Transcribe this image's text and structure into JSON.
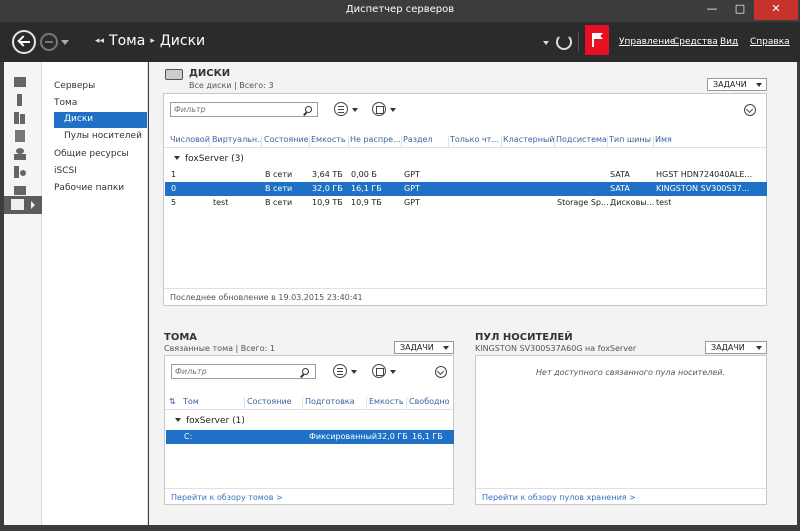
{
  "window": {
    "title": "Диспетчер серверов",
    "minimize": "—",
    "maximize": "□",
    "close": "✕"
  },
  "toolbar": {
    "breadcrumb": [
      "Тома",
      "Диски"
    ],
    "menus": [
      "Управление",
      "Средства",
      "Вид",
      "Справка"
    ]
  },
  "sidebar": {
    "items": [
      "Серверы",
      "Тома",
      "Диски",
      "Пулы носителей",
      "Общие ресурсы",
      "iSCSI",
      "Рабочие папки"
    ]
  },
  "disks": {
    "title": "ДИСКИ",
    "subtitle": "Все диски | Всего: 3",
    "tasks": "ЗАДАЧИ",
    "filter_placeholder": "Фильтр",
    "columns": [
      "Числовой",
      "Виртуальн...",
      "Состояние",
      "Емкость",
      "Не распре...",
      "Раздел",
      "Только чт...",
      "Кластерный",
      "Подсистема",
      "Тип шины",
      "Имя"
    ],
    "group": "foxServer (3)",
    "rows": [
      [
        "1",
        "",
        "В сети",
        "3,64 ТБ",
        "0,00 Б",
        "GPT",
        "",
        "",
        "",
        "SATA",
        "HGST HDN724040ALE..."
      ],
      [
        "0",
        "",
        "В сети",
        "32,0 ГБ",
        "16,1 ГБ",
        "GPT",
        "",
        "",
        "",
        "SATA",
        "KINGSTON SV300S37..."
      ],
      [
        "5",
        "test",
        "В сети",
        "10,9 ТБ",
        "10,9 ТБ",
        "GPT",
        "",
        "",
        "Storage Sp...",
        "Дисковы...",
        "test"
      ]
    ],
    "last_update": "Последнее обновление в 19.03.2015 23:40:41"
  },
  "volumes": {
    "title": "ТОМА",
    "subtitle": "Связанные тома | Всего: 1",
    "tasks": "ЗАДАЧИ",
    "filter_placeholder": "Фильтр",
    "columns": [
      "Том",
      "Состояние",
      "Подготовка",
      "Емкость",
      "Свободно"
    ],
    "group": "foxServer (1)",
    "rows": [
      [
        "C:",
        "",
        "Фиксированный",
        "32,0 ГБ",
        "16,1 ГБ"
      ]
    ],
    "link": "Перейти к обзору томов >"
  },
  "pool": {
    "title": "ПУЛ НОСИТЕЛЕЙ",
    "subtitle": "KINGSTON SV300S37A60G на foxServer",
    "tasks": "ЗАДАЧИ",
    "empty": "Нет доступного связанного пула носителей.",
    "link": "Перейти к обзору пулов хранения >"
  }
}
